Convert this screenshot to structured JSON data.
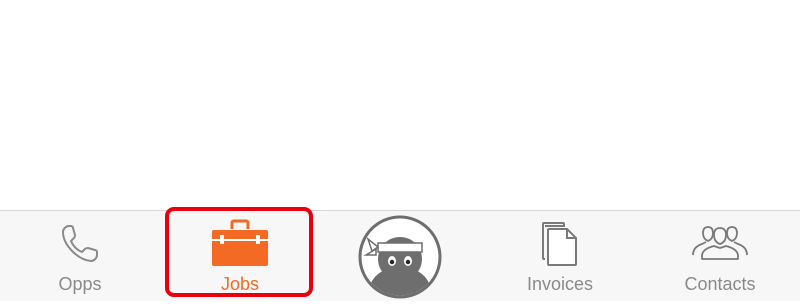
{
  "tabs": [
    {
      "id": "opps",
      "label": "Opps",
      "icon": "phone-icon"
    },
    {
      "id": "jobs",
      "label": "Jobs",
      "icon": "toolbox-icon",
      "active": true
    },
    {
      "id": "home",
      "label": "",
      "icon": "ninja-avatar-icon"
    },
    {
      "id": "invoices",
      "label": "Invoices",
      "icon": "documents-icon"
    },
    {
      "id": "contacts",
      "label": "Contacts",
      "icon": "people-icon"
    }
  ],
  "colors": {
    "accent": "#f26a24",
    "inactive": "#8a8a8a",
    "highlight": "#e8000d",
    "tab_bar_bg": "#f7f7f7"
  }
}
